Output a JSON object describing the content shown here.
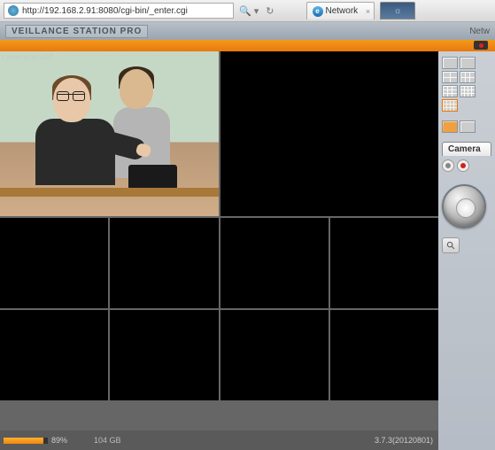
{
  "browser": {
    "url": "http://192.168.2.91:8080/cgi-bin/_enter.cgi",
    "search_hint": "🔍 ▾",
    "refresh": "↻",
    "tab_title": "Network",
    "tab_close": "×"
  },
  "header": {
    "logo": "veillance Station Pro",
    "right_label": "Netw"
  },
  "camera": {
    "label": "camerecordIP"
  },
  "status": {
    "percent": "89%",
    "storage": "104  GB",
    "version": "3.7.3(20120801)"
  },
  "side": {
    "camera_tab": "Camera "
  },
  "toolbar_icons": [
    "list-icon",
    "detail-icon",
    "image-icon",
    "cycle-icon",
    "snapshot-icon",
    "export-icon",
    "play-icon",
    "grid-icon",
    "fullscreen-icon"
  ]
}
